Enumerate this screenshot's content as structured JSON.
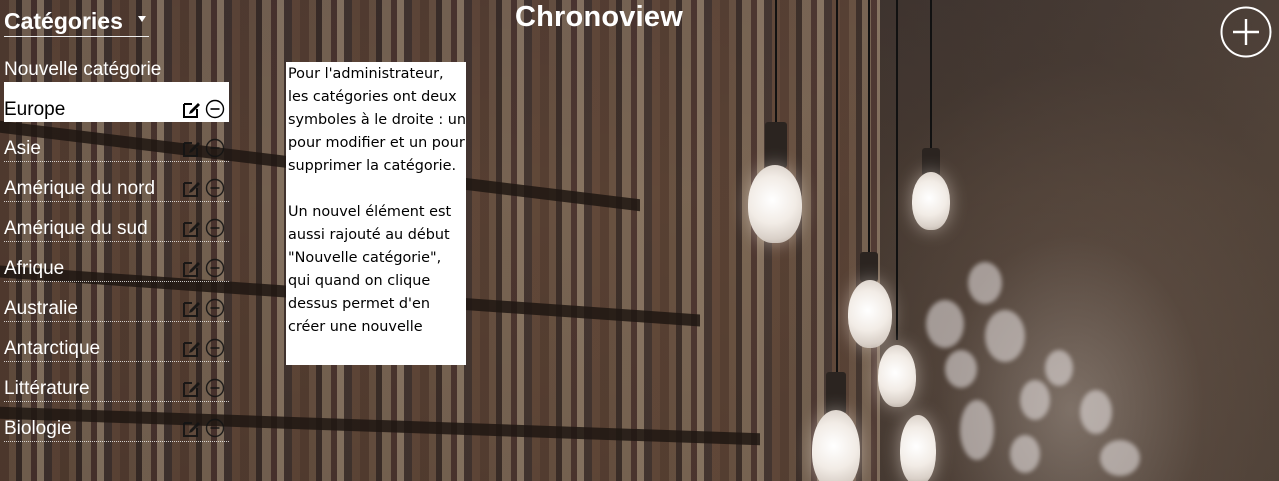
{
  "app": {
    "title": "Chronoview"
  },
  "categories_menu": {
    "label": "Catégories"
  },
  "new_category_label": "Nouvelle catégorie",
  "categories": [
    {
      "name": "Europe",
      "active": true
    },
    {
      "name": "Asie",
      "active": false
    },
    {
      "name": "Amérique du nord",
      "active": false
    },
    {
      "name": "Amérique du sud",
      "active": false
    },
    {
      "name": "Afrique",
      "active": false
    },
    {
      "name": "Australie",
      "active": false
    },
    {
      "name": "Antarctique",
      "active": false
    },
    {
      "name": "Littérature",
      "active": false
    },
    {
      "name": "Biologie",
      "active": false
    }
  ],
  "icons": {
    "edit": "edit-icon",
    "delete": "minus-circle-icon",
    "add": "plus-circle-icon",
    "caret": "caret-down-icon"
  },
  "annotation": {
    "paragraph1": "Pour l'administrateur, les catégories ont deux symboles à le droite : un pour modifier et un pour supprimer la catégorie.",
    "paragraph2": "Un nouvel élément est aussi rajouté au début \"Nouvelle catégorie\", qui quand on clique dessus permet d'en créer une nouvelle"
  },
  "colors": {
    "active_bg": "#ffffff",
    "text": "#ffffff",
    "annotation_bg": "#ffffff"
  }
}
